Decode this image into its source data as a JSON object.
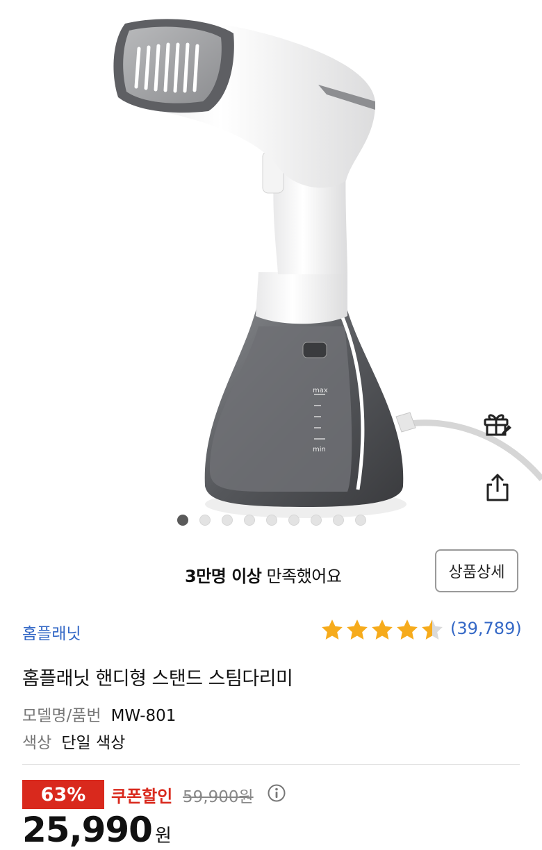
{
  "carousel": {
    "total": 9,
    "active_index": 0
  },
  "satisfaction": {
    "bold": "3만명 이상",
    "rest": " 만족했어요"
  },
  "detail_button": "상품상세",
  "brand": "홈플래닛",
  "rating": {
    "value": 4.5,
    "max": 5,
    "count": "(39,789)"
  },
  "product_name": "홈플래닛 핸디형 스탠드 스팀다리미",
  "specs": [
    {
      "key": "모델명/품번",
      "value": "MW-801"
    },
    {
      "key": "색상",
      "value": "단일 색상"
    }
  ],
  "pricing": {
    "discount": "63%",
    "coupon_label": "쿠폰할인",
    "original": "59,900원",
    "price": "25,990",
    "currency": "원"
  },
  "tank_labels": {
    "max": "max",
    "min": "min"
  },
  "icons": {
    "gift": "gift-icon",
    "share": "share-icon",
    "info": "info-icon",
    "star": "star-icon"
  },
  "colors": {
    "accent_blue": "#3468c6",
    "discount_red": "#d9291d",
    "star": "#f6ab1c"
  }
}
